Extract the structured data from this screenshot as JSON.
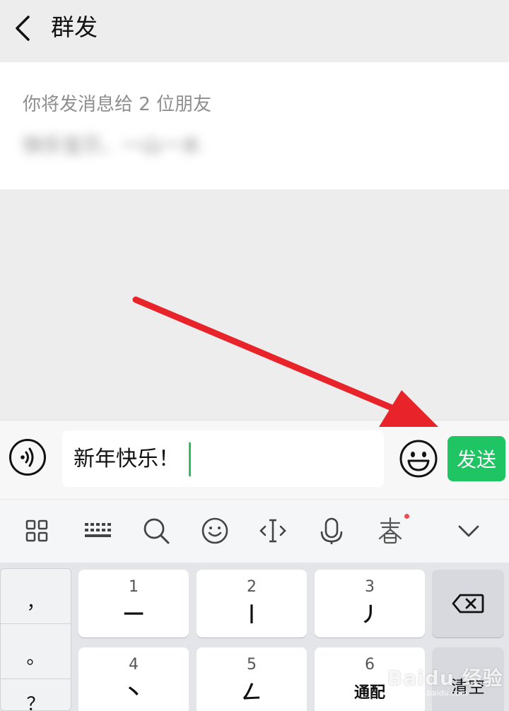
{
  "header": {
    "title": "群发"
  },
  "card": {
    "hint": "你将发消息给 2 位朋友",
    "recipients": "快乐宝贝、一山一水"
  },
  "input": {
    "text": "新年快乐！",
    "send_label": "发送"
  },
  "toolbar": {
    "icons": [
      "grid-icon",
      "keyboard-icon",
      "search-icon",
      "smiley-icon",
      "text-cursor-icon",
      "microphone-icon",
      "spring-festival-icon",
      "chevron-down-icon"
    ]
  },
  "keyboard": {
    "symbols": [
      "，",
      "。",
      "？"
    ],
    "keys": [
      {
        "num": "1",
        "stroke": "一"
      },
      {
        "num": "2",
        "stroke": "丨"
      },
      {
        "num": "3",
        "stroke": "丿"
      },
      {
        "num": "4",
        "stroke": "丶"
      },
      {
        "num": "5",
        "stroke": "𠃋"
      },
      {
        "num": "6",
        "stroke": "通配"
      }
    ],
    "clear_label": "清空"
  },
  "watermark": {
    "text": "Baidu 经验",
    "sub": "jingyan.baidu.com"
  },
  "colors": {
    "accent": "#1fc463",
    "arrow": "#e8232a",
    "background": "#ededed"
  }
}
